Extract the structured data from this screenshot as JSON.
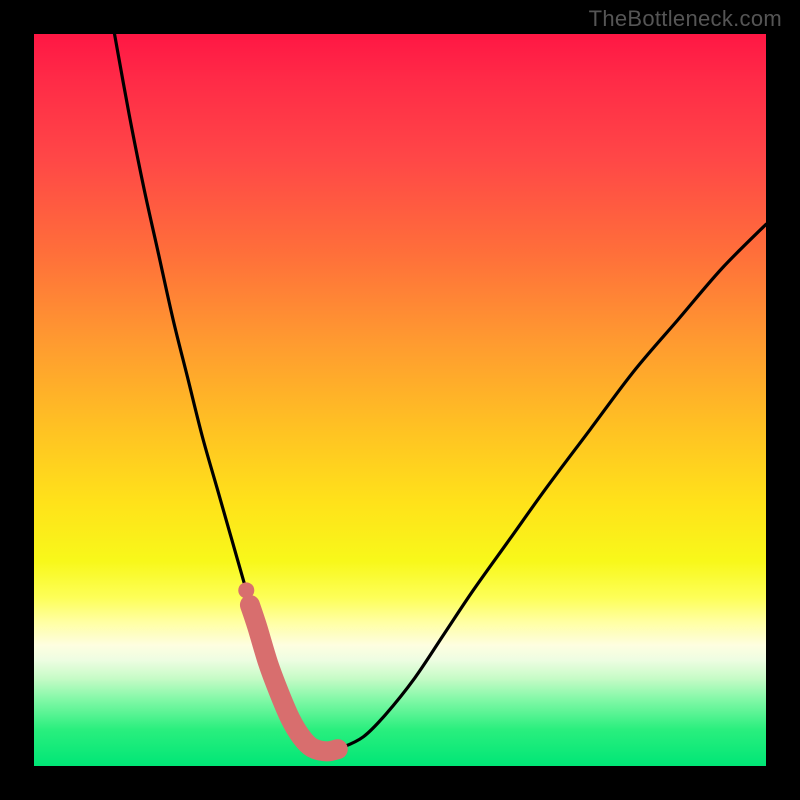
{
  "watermark": "TheBottleneck.com",
  "chart_data": {
    "type": "line",
    "title": "",
    "xlabel": "",
    "ylabel": "",
    "xlim": [
      0,
      100
    ],
    "ylim": [
      0,
      100
    ],
    "series": [
      {
        "name": "bottleneck-curve",
        "x": [
          11,
          13,
          15,
          17,
          19,
          21,
          23,
          25,
          27,
          29,
          30.5,
          32,
          33.5,
          35,
          36.5,
          38,
          40,
          42,
          45,
          48,
          52,
          56,
          60,
          65,
          70,
          76,
          82,
          88,
          94,
          100
        ],
        "y": [
          100,
          89,
          79,
          70,
          61,
          53,
          45,
          38,
          31,
          24,
          19,
          14,
          10,
          6.5,
          4,
          2.5,
          2,
          2.5,
          4,
          7,
          12,
          18,
          24,
          31,
          38,
          46,
          54,
          61,
          68,
          74
        ]
      },
      {
        "name": "highlight-segment",
        "x": [
          29.5,
          30.5,
          32,
          33.5,
          35,
          36.5,
          38,
          40,
          41.5
        ],
        "y": [
          22,
          19,
          14,
          10,
          6.5,
          4,
          2.5,
          2,
          2.3
        ]
      },
      {
        "name": "highlight-dot",
        "x": [
          29
        ],
        "y": [
          24
        ]
      }
    ],
    "colors": {
      "curve": "#000000",
      "highlight": "#d86e6e",
      "gradient_top": "#ff1744",
      "gradient_mid": "#ffe21a",
      "gradient_bottom": "#00e676"
    }
  }
}
